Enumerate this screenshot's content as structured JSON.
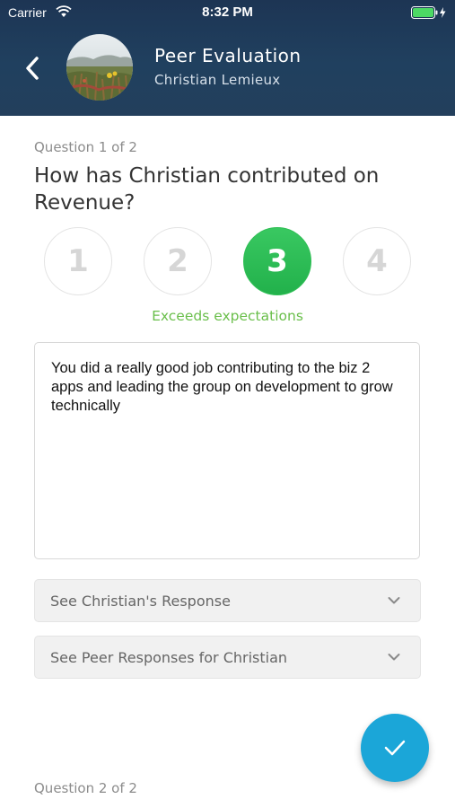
{
  "status_bar": {
    "carrier": "Carrier",
    "time": "8:32 PM",
    "icons": [
      "wifi-icon",
      "battery-icon",
      "charging-bolt-icon"
    ]
  },
  "header": {
    "title": "Peer Evaluation",
    "subtitle": "Christian Lemieux",
    "back_icon": "chevron-left-icon",
    "colors": {
      "background_top": "#1d3554",
      "background_bottom": "#233f5c"
    }
  },
  "question": {
    "counter": "Question 1 of 2",
    "text": "How has Christian contributed on Revenue?",
    "ratings": [
      "1",
      "2",
      "3",
      "4"
    ],
    "selected_rating": "3",
    "selected_label": "Exceeds expectations",
    "comment": "You did a really good job contributing to the biz 2 apps and leading the group on development to grow technically"
  },
  "accordions": [
    {
      "label": "See Christian's Response"
    },
    {
      "label": "See Peer Responses for Christian"
    }
  ],
  "fab": {
    "icon": "checkmark-icon",
    "color": "#1ba6d8"
  },
  "next_question": {
    "counter": "Question 2 of 2"
  },
  "colors": {
    "selected_green": "#2fbf55",
    "label_green": "#6abf4b",
    "accent_blue": "#1ba6d8"
  }
}
